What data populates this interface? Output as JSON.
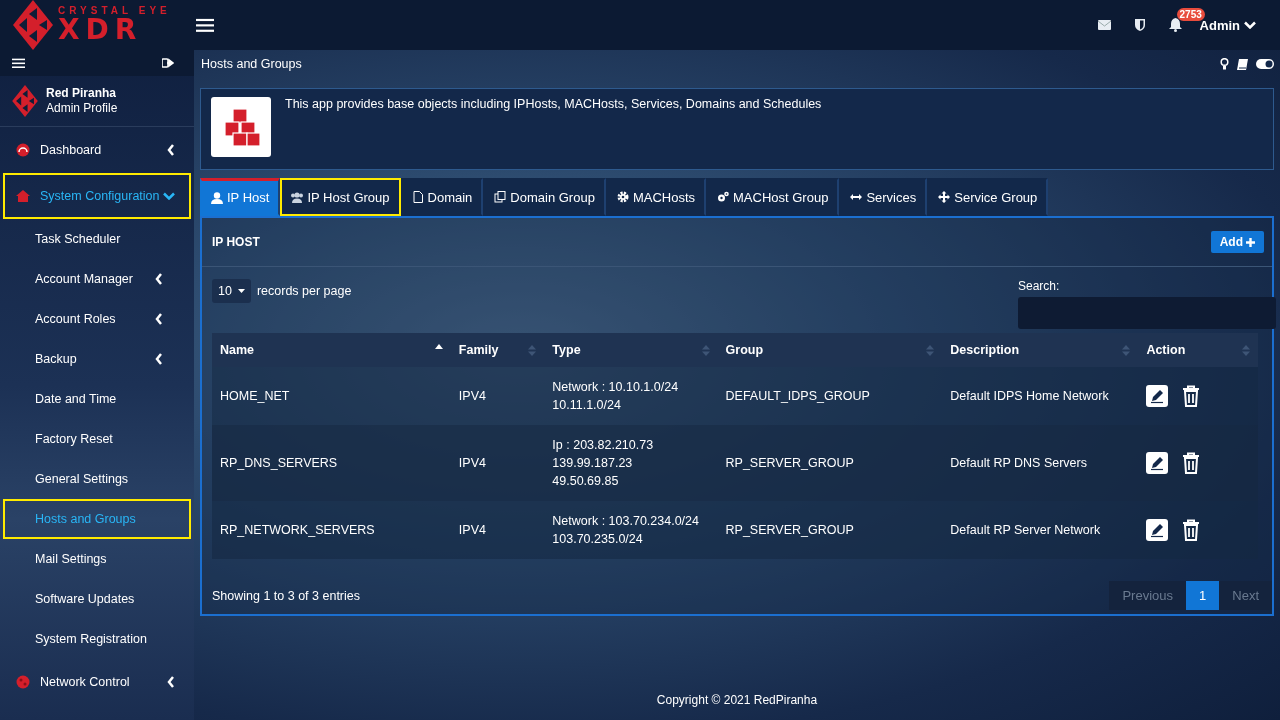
{
  "brand": {
    "top": "CRYSTAL EYE",
    "main": "XDR"
  },
  "topbar": {
    "notifications": "2753",
    "user": "Admin"
  },
  "profile": {
    "name": "Red Piranha",
    "role": "Admin Profile"
  },
  "sidebar": {
    "items": [
      {
        "label": "Dashboard",
        "expanded": false,
        "selected": false,
        "highlighted": false
      },
      {
        "label": "System Configuration",
        "expanded": true,
        "selected": true,
        "highlighted": true,
        "children": [
          {
            "label": "Task Scheduler",
            "has_submenu": false,
            "selected": false,
            "highlighted": false
          },
          {
            "label": "Account Manager",
            "has_submenu": true,
            "selected": false,
            "highlighted": false
          },
          {
            "label": "Account Roles",
            "has_submenu": true,
            "selected": false,
            "highlighted": false
          },
          {
            "label": "Backup",
            "has_submenu": true,
            "selected": false,
            "highlighted": false
          },
          {
            "label": "Date and Time",
            "has_submenu": false,
            "selected": false,
            "highlighted": false
          },
          {
            "label": "Factory Reset",
            "has_submenu": false,
            "selected": false,
            "highlighted": false
          },
          {
            "label": "General Settings",
            "has_submenu": false,
            "selected": false,
            "highlighted": false
          },
          {
            "label": "Hosts and Groups",
            "has_submenu": false,
            "selected": true,
            "highlighted": true
          },
          {
            "label": "Mail Settings",
            "has_submenu": false,
            "selected": false,
            "highlighted": false
          },
          {
            "label": "Software Updates",
            "has_submenu": false,
            "selected": false,
            "highlighted": false
          },
          {
            "label": "System Registration",
            "has_submenu": false,
            "selected": false,
            "highlighted": false
          }
        ]
      },
      {
        "label": "Network Control",
        "expanded": false,
        "selected": false,
        "highlighted": false
      }
    ]
  },
  "page_title": "Hosts and Groups",
  "app_info": "This app provides base objects including IPHosts, MACHosts, Services, Domains and Schedules",
  "tabs": [
    {
      "label": "IP Host",
      "selected": true,
      "highlighted": false
    },
    {
      "label": "IP Host Group",
      "selected": false,
      "highlighted": true
    },
    {
      "label": "Domain",
      "selected": false,
      "highlighted": false
    },
    {
      "label": "Domain Group",
      "selected": false,
      "highlighted": false
    },
    {
      "label": "MACHosts",
      "selected": false,
      "highlighted": false
    },
    {
      "label": "MACHost Group",
      "selected": false,
      "highlighted": false
    },
    {
      "label": "Services",
      "selected": false,
      "highlighted": false
    },
    {
      "label": "Service Group",
      "selected": false,
      "highlighted": false
    }
  ],
  "panel": {
    "title": "IP HOST",
    "add_button": "Add"
  },
  "length": {
    "value": "10",
    "suffix": "records per page"
  },
  "search": {
    "label": "Search:"
  },
  "table": {
    "columns": [
      {
        "label": "Name",
        "sorted": true
      },
      {
        "label": "Family",
        "sorted": false
      },
      {
        "label": "Type",
        "sorted": false
      },
      {
        "label": "Group",
        "sorted": false
      },
      {
        "label": "Description",
        "sorted": false
      },
      {
        "label": "Action",
        "sorted": false
      }
    ],
    "rows": [
      {
        "name": "HOME_NET",
        "family": "IPV4",
        "type": [
          "Network : 10.10.1.0/24",
          "10.11.1.0/24"
        ],
        "group": "DEFAULT_IDPS_GROUP",
        "description": "Default IDPS Home Network"
      },
      {
        "name": "RP_DNS_SERVERS",
        "family": "IPV4",
        "type": [
          "Ip : 203.82.210.73",
          "139.99.187.23",
          "49.50.69.85"
        ],
        "group": "RP_SERVER_GROUP",
        "description": "Default RP DNS Servers"
      },
      {
        "name": "RP_NETWORK_SERVERS",
        "family": "IPV4",
        "type": [
          "Network : 103.70.234.0/24",
          "103.70.235.0/24"
        ],
        "group": "RP_SERVER_GROUP",
        "description": "Default RP Server Network"
      }
    ]
  },
  "info": "Showing 1 to 3 of 3 entries",
  "pagination": [
    {
      "label": "Previous",
      "selected": false,
      "disabled": true
    },
    {
      "label": "1",
      "selected": true,
      "disabled": false
    },
    {
      "label": "Next",
      "selected": false,
      "disabled": true
    }
  ],
  "footer": "Copyright © 2021 RedPiranha"
}
